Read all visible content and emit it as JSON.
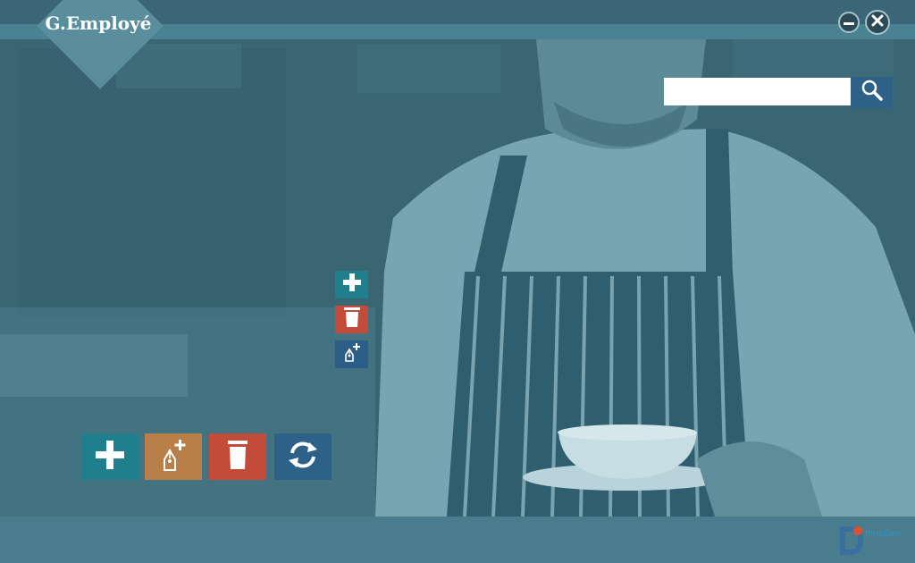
{
  "app": {
    "title": "G.Employé"
  },
  "window_controls": {
    "minimize_icon": "minimize-icon",
    "close_icon": "close-icon"
  },
  "search": {
    "value": "",
    "placeholder": "",
    "button_icon": "search-icon"
  },
  "quick_actions": [
    {
      "icon": "plus-icon",
      "color": "#1f7f8c"
    },
    {
      "icon": "trash-icon",
      "color": "#c44a3a"
    },
    {
      "icon": "pen-plus-icon",
      "color": "#2b5f87"
    }
  ],
  "main_actions": [
    {
      "icon": "plus-icon",
      "color": "#1f7f8c"
    },
    {
      "icon": "pen-plus-icon",
      "color": "#b88048"
    },
    {
      "icon": "trash-icon",
      "color": "#c44a3a"
    },
    {
      "icon": "refresh-icon",
      "color": "#2d6188"
    }
  ],
  "brand": {
    "name": "InnoDev"
  },
  "colors": {
    "titlebar": "#3a6677",
    "overlay": "#3f6e7d",
    "accent": "#2d6188"
  }
}
